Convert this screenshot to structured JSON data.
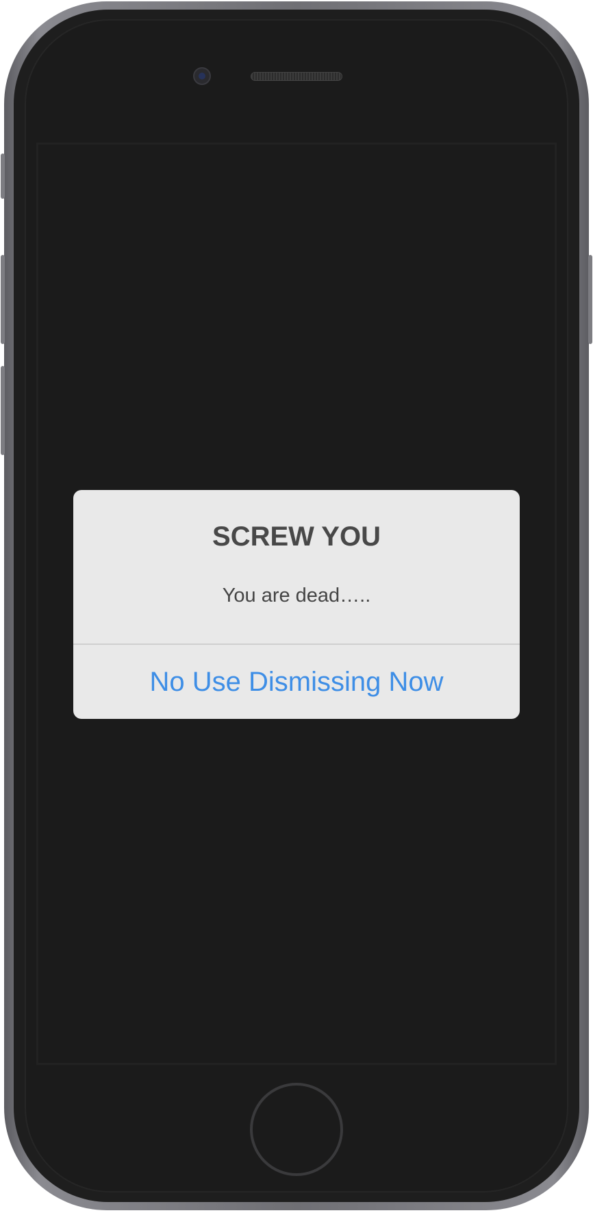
{
  "alert": {
    "title": "SCREW YOU",
    "message": "You are dead…..",
    "action_label": "No Use Dismissing Now"
  },
  "colors": {
    "screen": "#1b1b1b",
    "alert_background": "#e9e9e9",
    "alert_action": "#3e8ee6",
    "alert_text": "#484848"
  }
}
